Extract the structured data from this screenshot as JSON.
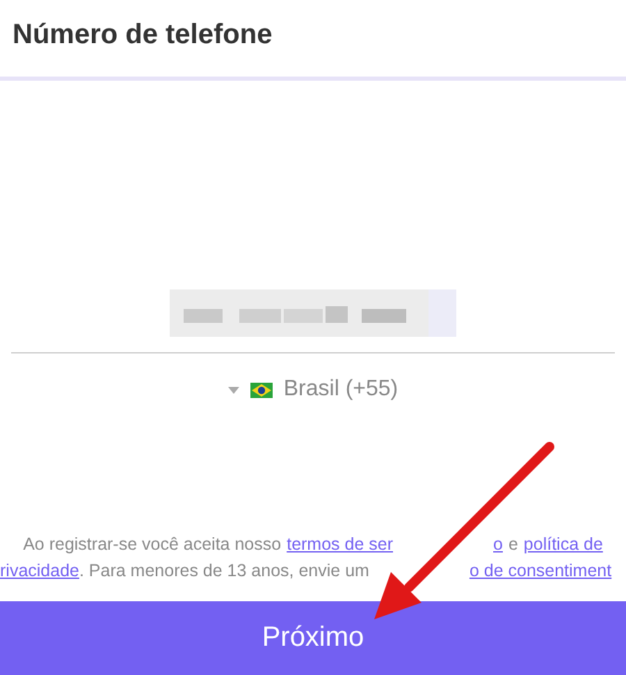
{
  "header": {
    "title": "Número de telefone"
  },
  "phone_field": {
    "country": "Brasil (+55)"
  },
  "consent": {
    "lines": [
      [
        {
          "kind": "text",
          "text": "Ao registrar-se você aceita nosso"
        },
        {
          "kind": "link",
          "text": "termos de ser"
        },
        {
          "kind": "covered"
        },
        {
          "kind": "link",
          "text": "o"
        },
        {
          "kind": "text",
          "text": "e"
        },
        {
          "kind": "link",
          "text": "política de"
        }
      ],
      [
        {
          "kind": "link",
          "text": "rivacidade"
        },
        {
          "kind": "text",
          "text": ". Para menores de 13 anos, envie um"
        },
        {
          "kind": "covered"
        },
        {
          "kind": "link",
          "text": "o de consentiment"
        }
      ]
    ]
  },
  "button": {
    "label": "Próximo"
  }
}
